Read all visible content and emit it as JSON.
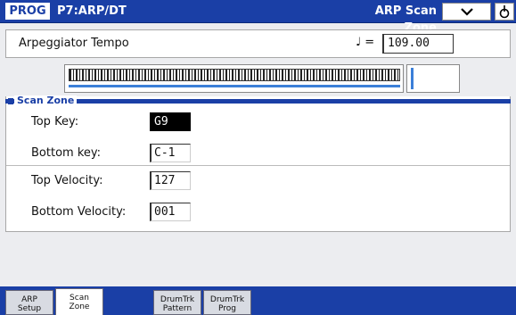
{
  "header": {
    "mode": "PROG",
    "page": "P7:ARP/DT",
    "title": "ARP Scan Zone"
  },
  "tempo": {
    "label": "Arpeggiator Tempo",
    "note_symbol": "♩ =",
    "value": "109.00"
  },
  "section": {
    "title": "Scan Zone",
    "top_key_label": "Top Key:",
    "top_key_value": "G9",
    "bottom_key_label": "Bottom key:",
    "bottom_key_value": "C-1",
    "top_velocity_label": "Top Velocity:",
    "top_velocity_value": "127",
    "bottom_velocity_label": "Bottom Velocity:",
    "bottom_velocity_value": "001"
  },
  "tabs": [
    {
      "line1": "ARP",
      "line2": "Setup"
    },
    {
      "line1": "Scan",
      "line2": "Zone"
    },
    {
      "line1": "DrumTrk",
      "line2": "Pattern"
    },
    {
      "line1": "DrumTrk",
      "line2": "Prog"
    }
  ],
  "colors": {
    "accent": "#1a3fa6",
    "range_bar": "#3b7fd8"
  },
  "icons": {
    "menu": "chevron-down-icon",
    "lock": "lock-icon"
  }
}
